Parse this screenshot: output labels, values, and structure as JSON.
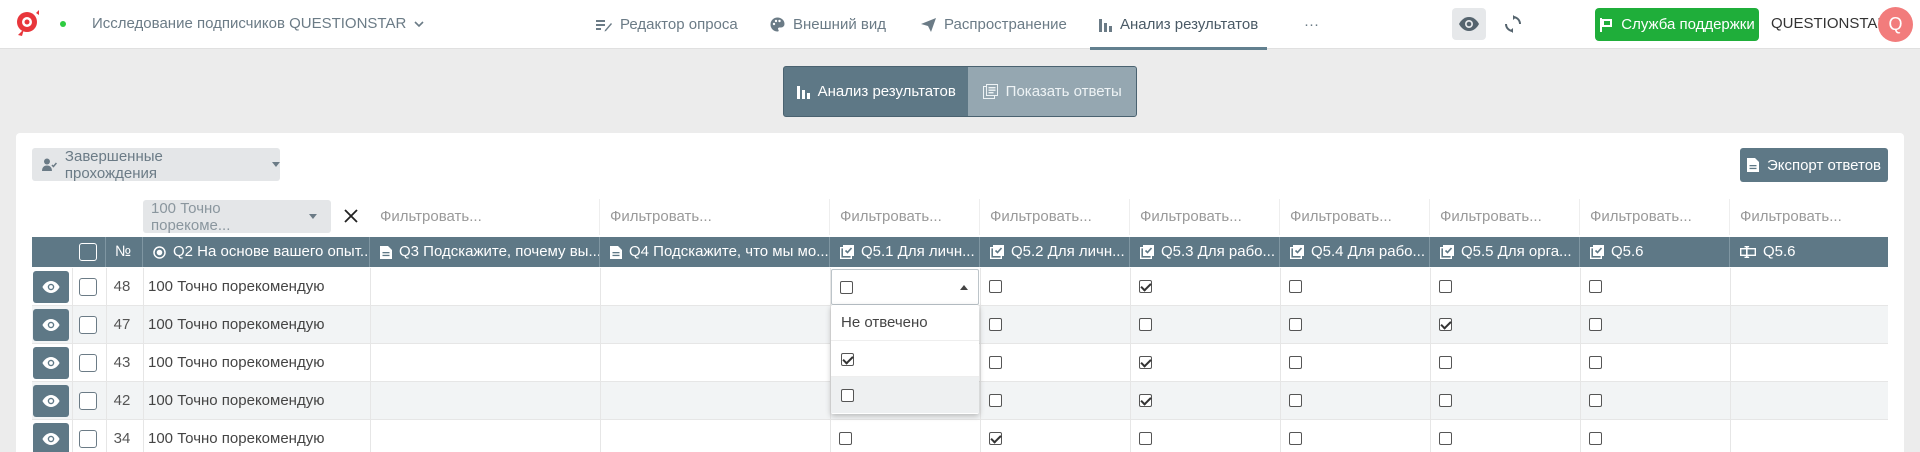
{
  "topbar": {
    "project_title": "Исследование подписчиков QUESTIONSTAR",
    "nav": [
      {
        "label": "Редактор опроса",
        "icon": "edit-list-icon"
      },
      {
        "label": "Внешний вид",
        "icon": "palette-icon"
      },
      {
        "label": "Распространение",
        "icon": "send-icon"
      },
      {
        "label": "Анализ результатов",
        "icon": "bar-chart-icon",
        "active": true
      }
    ],
    "more": "···",
    "support_label": "Служба поддержки",
    "brand": "QUESTIONSTAR",
    "avatar_letter": "Q"
  },
  "mode_toggle": {
    "analysis_label": "Анализ результатов",
    "answers_label": "Показать ответы"
  },
  "toolbar": {
    "filter_dropdown": "Завершенные прохождения",
    "export_label": "Экспорт ответов"
  },
  "filters": {
    "q2_selected": "100 Точно порекоме...",
    "placeholder": "Фильтровать..."
  },
  "table": {
    "num_header": "№",
    "columns": [
      "Q2 На основе вашего опыт...",
      "Q3 Подскажите, почему вы...",
      "Q4 Подскажите, что мы мо...",
      "Q5.1 Для личн...",
      "Q5.2 Для личн...",
      "Q5.3 Для рабо...",
      "Q5.4 Для рабо...",
      "Q5.5 Для орга...",
      "Q5.6",
      "Q5.6"
    ],
    "rows": [
      {
        "num": "48",
        "q2": "100 Точно порекомендую",
        "checks": [
          false,
          false,
          true,
          false,
          false,
          false
        ]
      },
      {
        "num": "47",
        "q2": "100 Точно порекомендую",
        "checks": [
          false,
          false,
          false,
          false,
          true,
          false
        ]
      },
      {
        "num": "43",
        "q2": "100 Точно порекомендую",
        "checks": [
          false,
          false,
          true,
          false,
          false,
          false
        ]
      },
      {
        "num": "42",
        "q2": "100 Точно порекомендую",
        "checks": [
          false,
          false,
          true,
          false,
          false,
          false
        ]
      },
      {
        "num": "34",
        "q2": "100 Точно порекомендую",
        "checks": [
          false,
          true,
          false,
          false,
          false,
          false
        ]
      }
    ]
  },
  "dropdown_menu": {
    "options": [
      "Не отвечено",
      "☑",
      "☐"
    ]
  },
  "colors": {
    "accent": "#5e7886",
    "support_green": "#1fae3a",
    "avatar": "#f27c7c"
  }
}
